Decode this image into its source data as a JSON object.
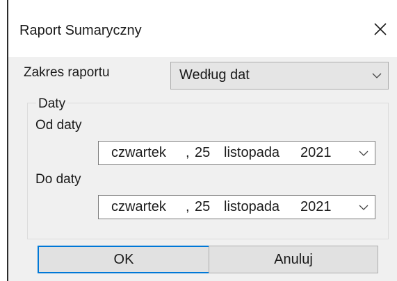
{
  "dialog": {
    "title": "Raport Sumaryczny",
    "close_icon": "close-icon"
  },
  "report_range": {
    "label": "Zakres raportu",
    "selected": "Według dat",
    "dropdown_icon": "chevron-down-icon"
  },
  "dates_group": {
    "caption": "Daty",
    "from": {
      "label": "Od daty",
      "weekday": "czwartek",
      "day_sep": ",",
      "day": "25",
      "month": "listopada",
      "year": "2021",
      "dropdown_icon": "chevron-down-icon"
    },
    "to": {
      "label": "Do daty",
      "weekday": "czwartek",
      "day_sep": ",",
      "day": "25",
      "month": "listopada",
      "year": "2021",
      "dropdown_icon": "chevron-down-icon"
    }
  },
  "buttons": {
    "ok": "OK",
    "cancel": "Anuluj"
  },
  "colors": {
    "accent": "#0078d7",
    "client_bg": "#f0f0f0",
    "button_bg": "#e1e1e1"
  }
}
